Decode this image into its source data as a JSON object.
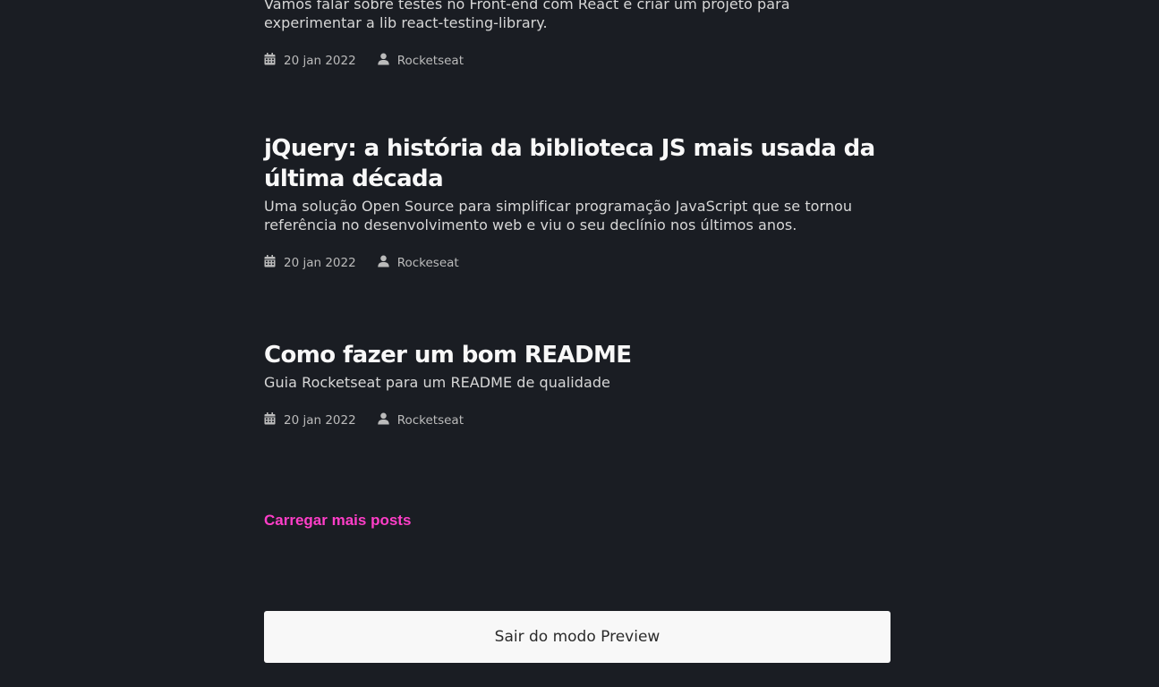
{
  "posts": [
    {
      "title": "",
      "subtitle": "Vamos falar sobre testes no Front-end com React e criar um projeto para experimentar a lib react-testing-library.",
      "date": "20 jan 2022",
      "author": "Rocketseat"
    },
    {
      "title": "jQuery: a história da biblioteca JS mais usada da última década",
      "subtitle": "Uma solução Open Source para simplificar programação JavaScript que se tornou referência no desenvolvimento web e viu o seu declínio nos últimos anos.",
      "date": "20 jan 2022",
      "author": "Rockeseat"
    },
    {
      "title": "Como fazer um bom README",
      "subtitle": "Guia Rocketseat para um README de qualidade",
      "date": "20 jan 2022",
      "author": "Rocketseat"
    }
  ],
  "load_more_label": "Carregar mais posts",
  "preview_exit_label": "Sair do modo Preview",
  "icons": {
    "date": "calendar-icon",
    "author": "user-icon"
  },
  "colors": {
    "background": "#1a1d23",
    "title": "#f8f8f8",
    "accent": "#ff3ec8",
    "button_bg": "#f8f8f8"
  }
}
